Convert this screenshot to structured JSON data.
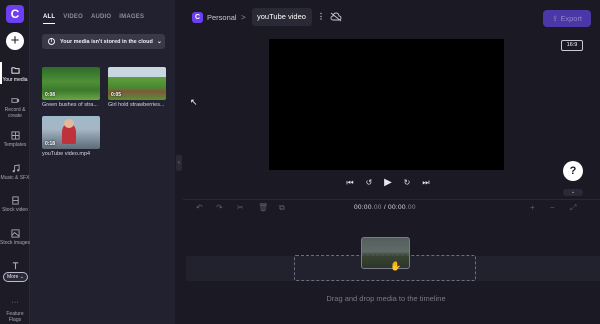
{
  "app": {
    "logo_letter": "C",
    "accent": "#6d3ff2"
  },
  "rail": {
    "add_label": "+",
    "items": [
      {
        "label": "Your media",
        "icon": "folder-icon",
        "active": true
      },
      {
        "label": "Record & create",
        "icon": "video-camera-icon"
      },
      {
        "label": "Templates",
        "icon": "templates-grid-icon"
      },
      {
        "label": "Music & SFX",
        "icon": "music-note-icon"
      },
      {
        "label": "Stock video",
        "icon": "film-icon"
      },
      {
        "label": "Stock images",
        "icon": "image-icon"
      },
      {
        "label": "Text",
        "icon": "text-icon"
      }
    ],
    "more_label": "More",
    "feature_label": "Feature Flags"
  },
  "media": {
    "tabs": [
      "ALL",
      "VIDEO",
      "AUDIO",
      "IMAGES"
    ],
    "active_tab": "ALL",
    "banner_text": "Your media isn't stored in the cloud",
    "items": [
      {
        "name": "Green bushes of stra...",
        "duration": "0:08"
      },
      {
        "name": "Girl hold strawberries...",
        "duration": "0:05"
      },
      {
        "name": "youTube video.mp4",
        "duration": "0:18"
      }
    ]
  },
  "header": {
    "workspace": "Personal",
    "separator": ">",
    "project_title": "youTube video",
    "export_label": "Export",
    "aspect_ratio": "16:9"
  },
  "player": {
    "current_time": "00:00",
    "current_frames": ".00",
    "total_time": "00:00",
    "total_frames": ".00",
    "separator": " / "
  },
  "help": {
    "label": "?"
  },
  "timeline": {
    "drop_message": "Drag and drop media to the timeline"
  }
}
